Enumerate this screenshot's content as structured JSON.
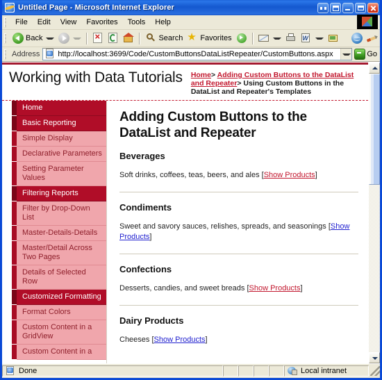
{
  "window": {
    "title": "Untitled Page - Microsoft Internet Explorer",
    "app_icon": "ie-document-icon",
    "buttons": {
      "restore_left": "restore-left",
      "restore_group": "restore-group",
      "minimize": "minimize",
      "maximize": "maximize",
      "close": "close"
    }
  },
  "menu": {
    "items": [
      {
        "label": "File"
      },
      {
        "label": "Edit"
      },
      {
        "label": "View"
      },
      {
        "label": "Favorites"
      },
      {
        "label": "Tools"
      },
      {
        "label": "Help"
      }
    ]
  },
  "toolbar": {
    "back_label": "Back",
    "search_label": "Search",
    "favorites_label": "Favorites",
    "icons": [
      "back-icon",
      "forward-icon",
      "stop-icon",
      "refresh-icon",
      "home-icon",
      "search-icon",
      "favorites-star-icon",
      "media-icon",
      "mail-icon",
      "print-icon",
      "edit-word-icon",
      "messenger-icon",
      "globe-icon",
      "pen-icon",
      "research-icon",
      "grid-icon"
    ]
  },
  "address": {
    "label": "Address",
    "url": "http://localhost:3699/Code/CustomButtonsDataListRepeater/CustomButtons.aspx",
    "go_label": "Go"
  },
  "page": {
    "site_title": "Working with Data Tutorials",
    "breadcrumb": {
      "home": "Home",
      "sep1": ">",
      "parent": "Adding Custom Buttons to the DataList and Repeater",
      "sep2": ">",
      "current": "Using Custom Buttons in the DataList and Repeater's Templates"
    },
    "heading": "Adding Custom Buttons to the DataList and Repeater",
    "sidebar": {
      "items": [
        {
          "label": "Home",
          "type": "section"
        },
        {
          "label": "Basic Reporting",
          "type": "section"
        },
        {
          "label": "Simple Display",
          "type": "item"
        },
        {
          "label": "Declarative Parameters",
          "type": "item"
        },
        {
          "label": "Setting Parameter Values",
          "type": "item"
        },
        {
          "label": "Filtering Reports",
          "type": "section"
        },
        {
          "label": "Filter by Drop-Down List",
          "type": "item"
        },
        {
          "label": "Master-Details-Details",
          "type": "item"
        },
        {
          "label": "Master/Detail Across Two Pages",
          "type": "item"
        },
        {
          "label": "Details of Selected Row",
          "type": "item"
        },
        {
          "label": "Customized Formatting",
          "type": "section"
        },
        {
          "label": "Format Colors",
          "type": "item"
        },
        {
          "label": "Custom Content in a GridView",
          "type": "item"
        },
        {
          "label": "Custom Content in a",
          "type": "item"
        }
      ]
    },
    "categories": [
      {
        "name": "Beverages",
        "description": "Soft drinks, coffees, teas, beers, and ales",
        "link_open": "[",
        "link_label": "Show Products",
        "link_close": "]",
        "link_state": "red",
        "rule_after": true
      },
      {
        "name": "Condiments",
        "description": "Sweet and savory sauces, relishes, spreads, and seasonings",
        "link_open": "[",
        "link_label": "Show Products",
        "link_close": "]",
        "link_state": "blue",
        "rule_after": true
      },
      {
        "name": "Confections",
        "description": "Desserts, candies, and sweet breads",
        "link_open": "[",
        "link_label": "Show Products",
        "link_close": "]",
        "link_state": "red",
        "rule_after": true
      },
      {
        "name": "Dairy Products",
        "description": "Cheeses",
        "link_open": "[",
        "link_label": "Show Products",
        "link_close": "]",
        "link_state": "blue",
        "rule_after": false
      }
    ]
  },
  "statusbar": {
    "status": "Done",
    "zone": "Local intranet"
  },
  "colors": {
    "accent_red": "#c2172e",
    "nav_section_bg": "#b00d28",
    "nav_item_bg": "#f0a6ac",
    "link_visited": "#2020cf",
    "titlebar_blue": "#1458cf"
  }
}
